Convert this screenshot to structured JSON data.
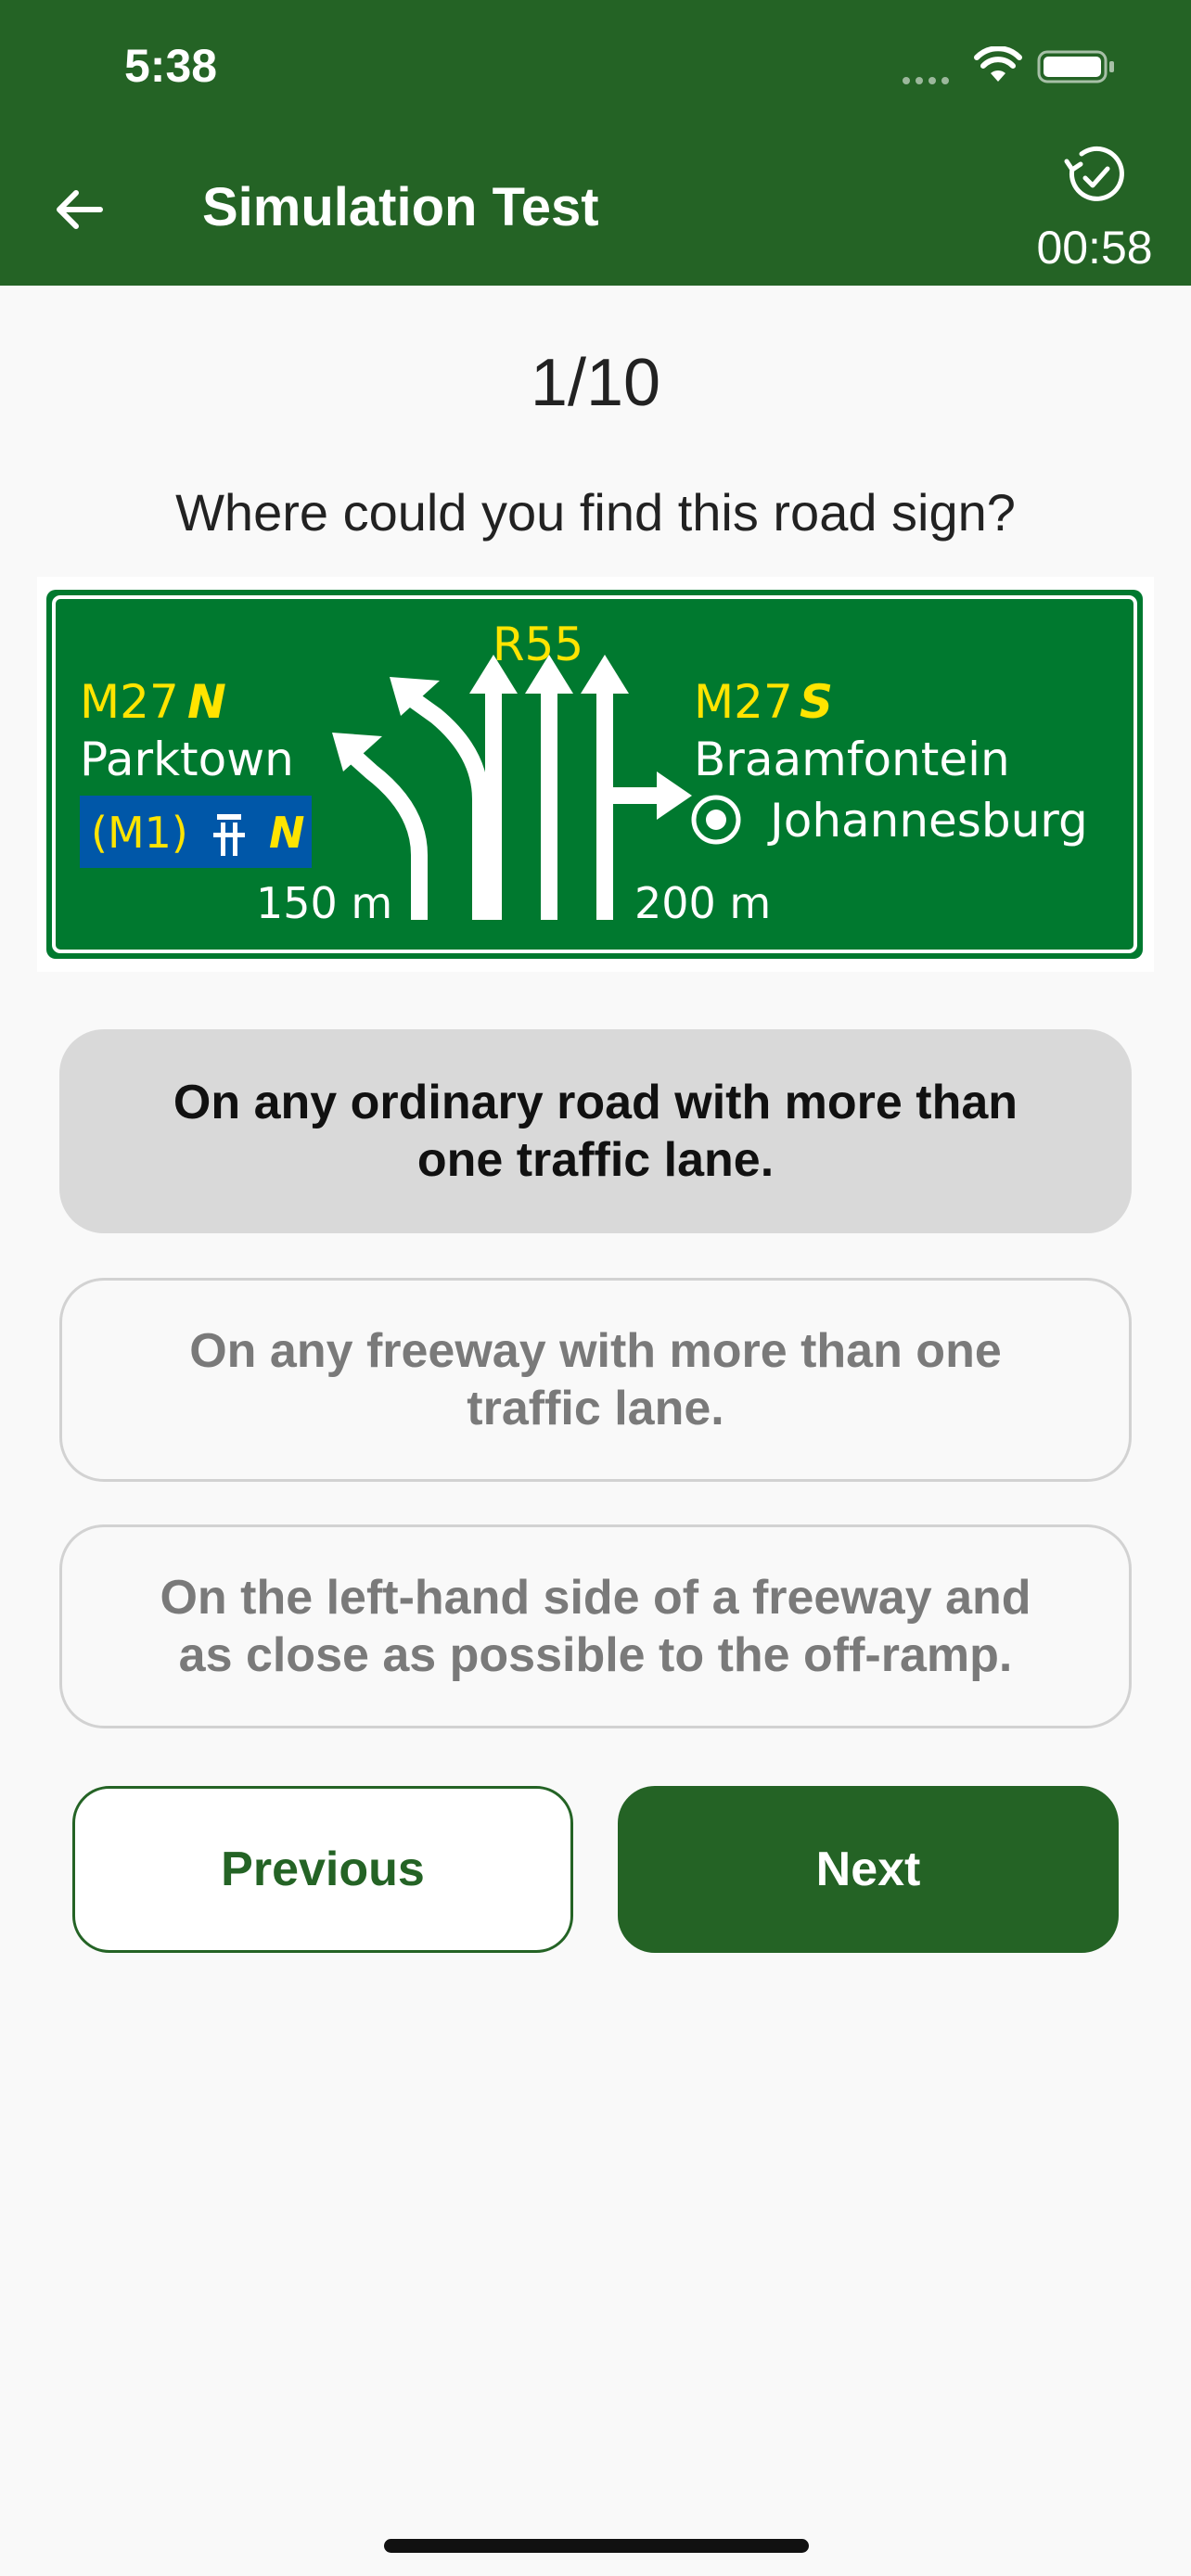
{
  "status_bar": {
    "time": "5:38"
  },
  "header": {
    "title": "Simulation Test",
    "timer": "00:58"
  },
  "quiz": {
    "progress": "1/10",
    "question": "Where could you find this road sign?",
    "answers": [
      {
        "text": "On any ordinary road with more than one traffic lane.",
        "selected": true
      },
      {
        "text": "On any freeway with more than one traffic lane.",
        "selected": false
      },
      {
        "text": "On the left-hand side of a freeway and as close as possible to the off-ramp.",
        "selected": false
      }
    ]
  },
  "sign": {
    "route_top": "R55",
    "left_route": "M27",
    "left_route_dir": "N",
    "left_place": "Parktown",
    "left_freeway": "(M1)",
    "left_freeway_dir": "N",
    "left_distance": "150 m",
    "right_route": "M27",
    "right_route_dir": "S",
    "right_place": "Braamfontein",
    "right_city": "Johannesburg",
    "right_distance": "200 m"
  },
  "buttons": {
    "previous": "Previous",
    "next": "Next"
  },
  "colors": {
    "brand_green": "#246325",
    "sign_green": "#00792f",
    "sign_yellow": "#ffe400",
    "sign_blue": "#0057a8",
    "selected_bg": "#d9d9d9"
  }
}
